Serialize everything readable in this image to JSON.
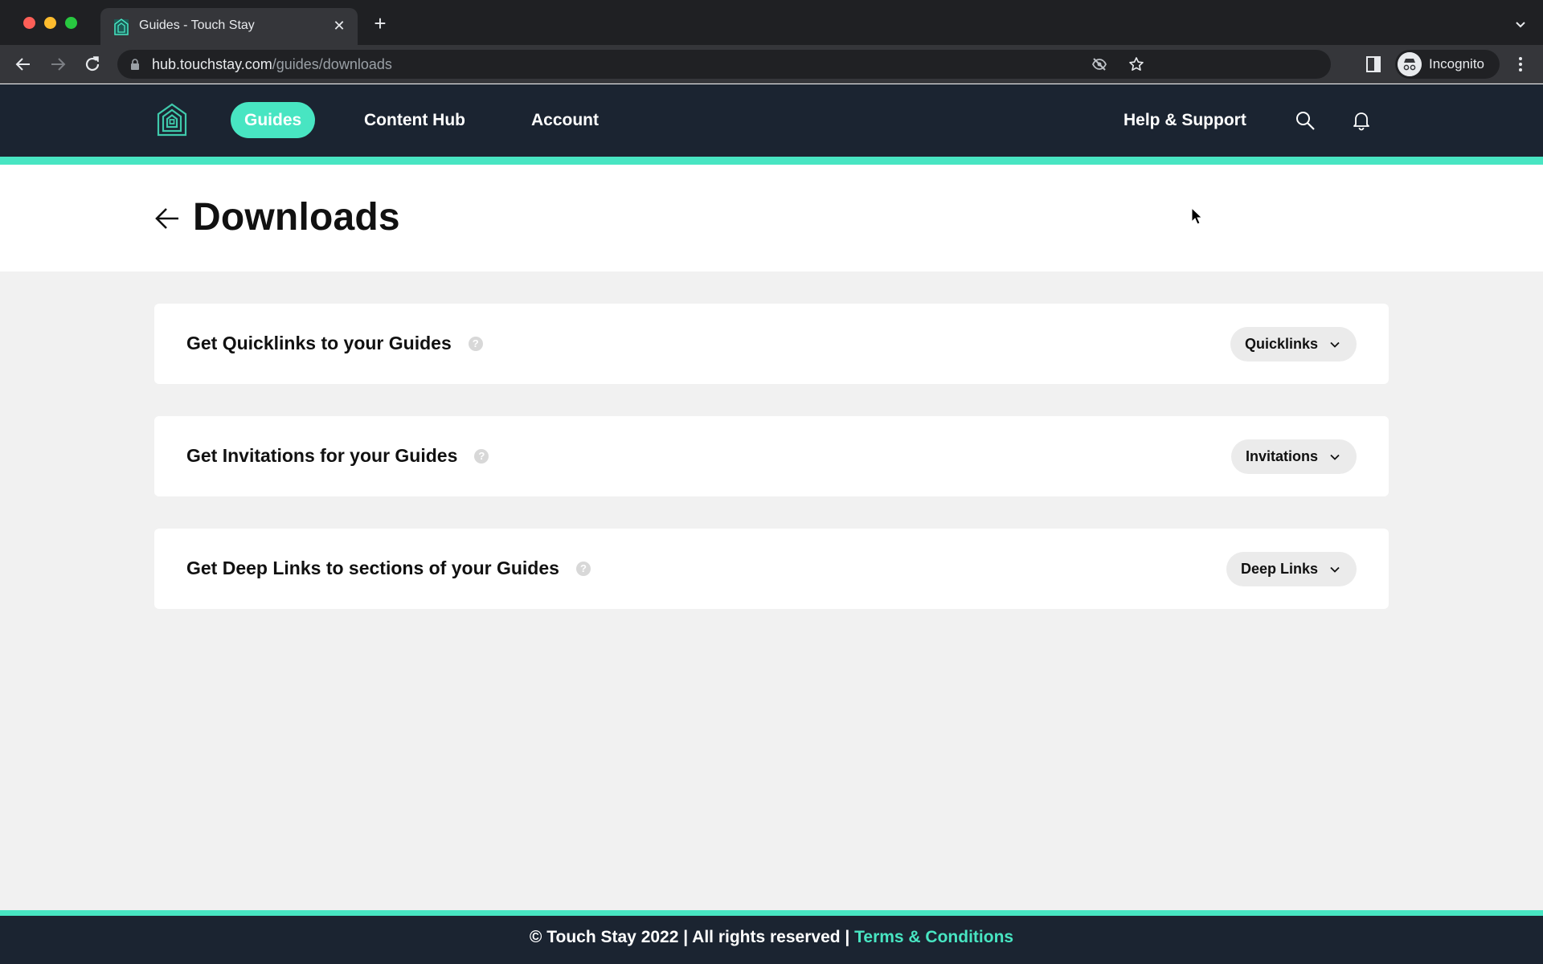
{
  "browser": {
    "tab_title": "Guides - Touch Stay",
    "url_host": "hub.touchstay.com",
    "url_path": "/guides/downloads",
    "profile_label": "Incognito"
  },
  "nav": {
    "items": [
      {
        "label": "Guides",
        "active": true
      },
      {
        "label": "Content Hub",
        "active": false
      },
      {
        "label": "Account",
        "active": false
      }
    ],
    "help_label": "Help & Support"
  },
  "page": {
    "title": "Downloads"
  },
  "cards": [
    {
      "title": "Get Quicklinks to your Guides",
      "dropdown_label": "Quicklinks"
    },
    {
      "title": "Get Invitations for your Guides",
      "dropdown_label": "Invitations"
    },
    {
      "title": "Get Deep Links to sections of your Guides",
      "dropdown_label": "Deep Links"
    }
  ],
  "footer": {
    "text": "© Touch Stay 2022 | All rights reserved | ",
    "link_label": "Terms & Conditions"
  },
  "icons": {
    "help": "?"
  },
  "colors": {
    "accent": "#48e5c2",
    "nav_bg": "#1b2431",
    "page_bg": "#f1f1f1"
  }
}
